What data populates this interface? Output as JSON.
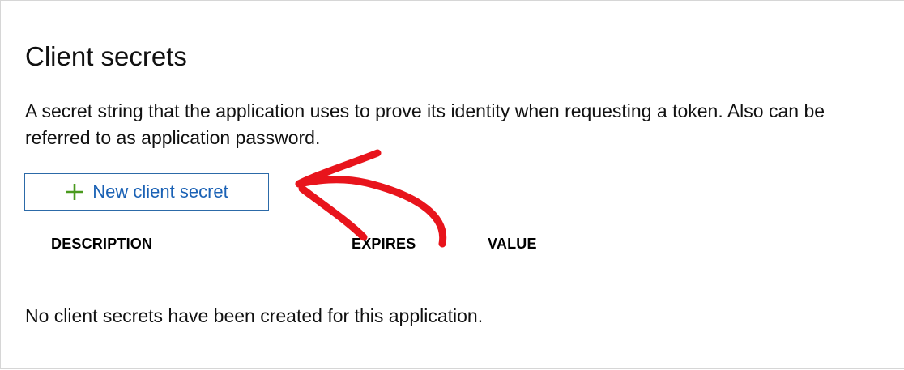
{
  "section": {
    "title": "Client secrets",
    "description_line1": "A secret string that the application uses to prove its identity when requesting a token. Also can be",
    "description_line2": "referred to as application password."
  },
  "actions": {
    "new_secret_label": "New client secret",
    "new_secret_icon": "plus-icon",
    "icon_color": "#4a9a1e"
  },
  "table": {
    "columns": [
      "DESCRIPTION",
      "EXPIRES",
      "VALUE"
    ],
    "empty_message": "No client secrets have been created for this application."
  },
  "annotation": {
    "type": "hand-drawn arrow",
    "color": "#e8141c"
  }
}
